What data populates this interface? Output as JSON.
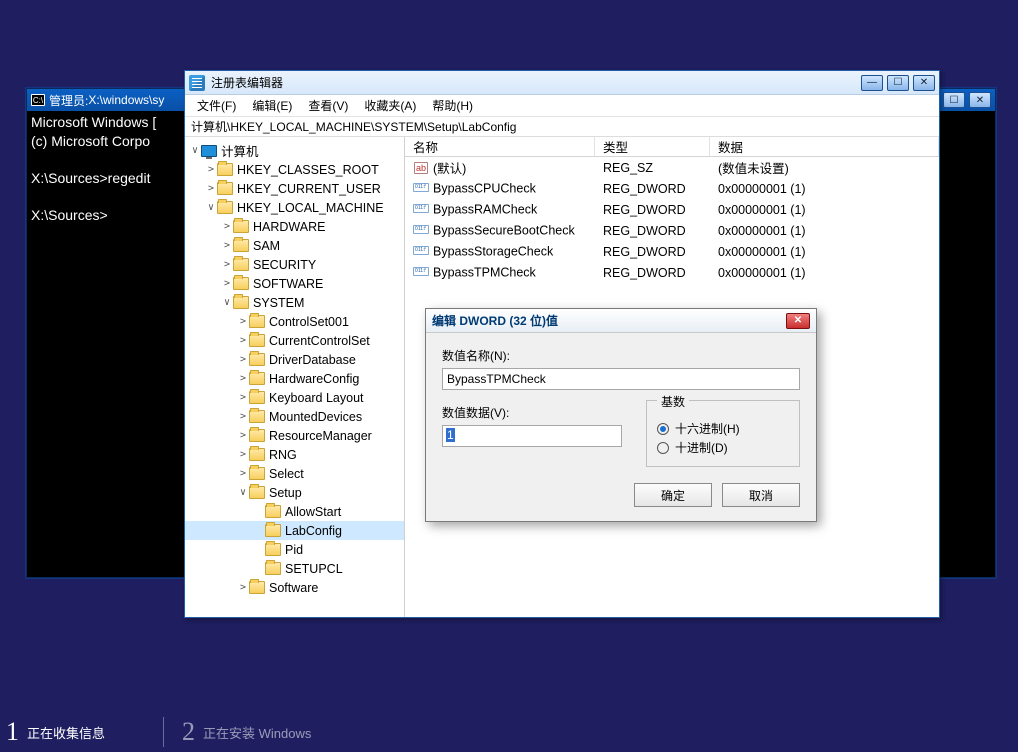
{
  "setup": {
    "step1": "正在收集信息",
    "step2": "正在安装 Windows"
  },
  "cmd": {
    "title_prefix": "管理员: ",
    "title_path": "X:\\windows\\sy",
    "line1": "Microsoft Windows [",
    "line2": "(c) Microsoft Corpo",
    "prompt1": "X:\\Sources>regedit",
    "prompt2": "X:\\Sources>"
  },
  "reg": {
    "title": "注册表编辑器",
    "menu": {
      "file": "文件(F)",
      "edit": "编辑(E)",
      "view": "查看(V)",
      "fav": "收藏夹(A)",
      "help": "帮助(H)"
    },
    "address": "计算机\\HKEY_LOCAL_MACHINE\\SYSTEM\\Setup\\LabConfig",
    "tree": {
      "root": "计算机",
      "hkcr": "HKEY_CLASSES_ROOT",
      "hkcu": "HKEY_CURRENT_USER",
      "hklm": "HKEY_LOCAL_MACHINE",
      "hklm_children": [
        "HARDWARE",
        "SAM",
        "SECURITY",
        "SOFTWARE",
        "SYSTEM"
      ],
      "system_children": [
        "ControlSet001",
        "CurrentControlSet",
        "DriverDatabase",
        "HardwareConfig",
        "Keyboard Layout",
        "MountedDevices",
        "ResourceManager",
        "RNG",
        "Select",
        "Setup"
      ],
      "setup_children": [
        "AllowStart",
        "LabConfig",
        "Pid",
        "SETUPCL"
      ],
      "trailing": "Software"
    },
    "cols": {
      "name": "名称",
      "type": "类型",
      "data": "数据"
    },
    "values": [
      {
        "icon": "sz",
        "name": "(默认)",
        "type": "REG_SZ",
        "data": "(数值未设置)"
      },
      {
        "icon": "dw",
        "name": "BypassCPUCheck",
        "type": "REG_DWORD",
        "data": "0x00000001 (1)"
      },
      {
        "icon": "dw",
        "name": "BypassRAMCheck",
        "type": "REG_DWORD",
        "data": "0x00000001 (1)"
      },
      {
        "icon": "dw",
        "name": "BypassSecureBootCheck",
        "type": "REG_DWORD",
        "data": "0x00000001 (1)"
      },
      {
        "icon": "dw",
        "name": "BypassStorageCheck",
        "type": "REG_DWORD",
        "data": "0x00000001 (1)"
      },
      {
        "icon": "dw",
        "name": "BypassTPMCheck",
        "type": "REG_DWORD",
        "data": "0x00000001 (1)"
      }
    ]
  },
  "dlg": {
    "title": "编辑 DWORD (32 位)值",
    "name_label": "数值名称(N):",
    "name_value": "BypassTPMCheck",
    "data_label": "数值数据(V):",
    "data_value": "1",
    "base_label": "基数",
    "radio_hex": "十六进制(H)",
    "radio_dec": "十进制(D)",
    "ok": "确定",
    "cancel": "取消"
  }
}
